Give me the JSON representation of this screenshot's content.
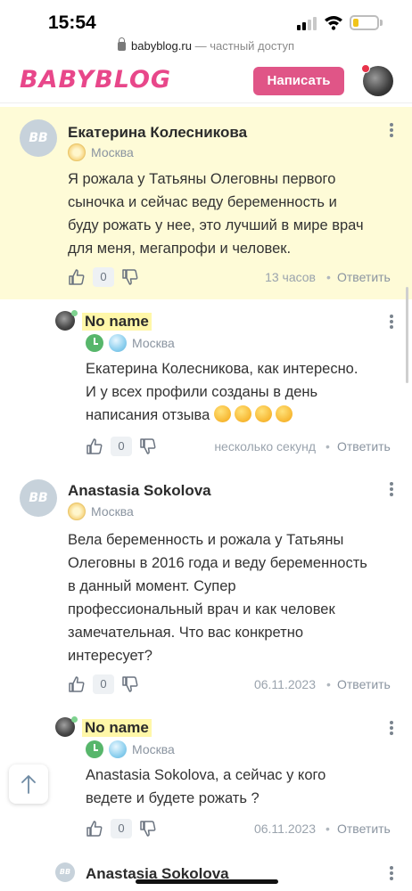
{
  "status_bar": {
    "time": "15:54"
  },
  "browser": {
    "domain": "babyblog.ru",
    "separator": " — ",
    "access": "частный доступ"
  },
  "header": {
    "logo": "BABYBLOG",
    "write_button": "Написать"
  },
  "comments": [
    {
      "author": "Екатерина Колесникова",
      "avatar": "BB",
      "city": "Москва",
      "text_lines": [
        "Я рожала у Татьяны Олеговны первого",
        "сыночка и сейчас веду беременность и",
        "буду рожать у нее, это лучший в мире врач",
        "для меня, мегапрофи и человек."
      ],
      "votes": "0",
      "time": "13 часов",
      "reply": "Ответить"
    },
    {
      "author": "No name",
      "city": "Москва",
      "text_lines": [
        "Екатерина Колесникова, как интересно.",
        "И у всех профили созданы в день",
        "написания отзыва"
      ],
      "votes": "0",
      "time": "несколько секунд",
      "reply": "Ответить"
    },
    {
      "author": "Anastasia Sokolova",
      "avatar": "BB",
      "city": "Москва",
      "text_lines": [
        "Вела беременность и рожала у Татьяны",
        "Олеговны в 2016 года и веду беременность",
        "в данный момент. Супер",
        "профессиональный врач и как человек",
        "замечательная. Что вас конкретно",
        "интересует?"
      ],
      "votes": "0",
      "time": "06.11.2023",
      "reply": "Ответить"
    },
    {
      "author": "No name",
      "city": "Москва",
      "text_lines": [
        "Anastasia Sokolova, а сейчас у кого",
        "ведете и будете рожать ?"
      ],
      "votes": "0",
      "time": "06.11.2023",
      "reply": "Ответить"
    },
    {
      "author": "Anastasia Sokolova",
      "avatar": "BB"
    }
  ]
}
